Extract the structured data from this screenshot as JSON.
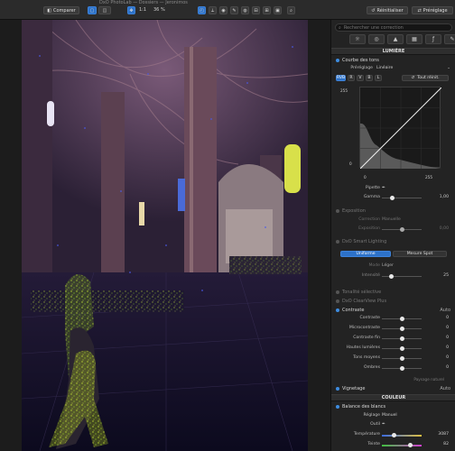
{
  "toolbar": {
    "window_title": "DxO PhotoLab — Dossiers — Jeronimos",
    "compare_label": "Comparer",
    "zoom_ratio": "1:1",
    "zoom_percent": "36 %",
    "reset_label": "Réinitialiser",
    "presets_label": "Préréglage"
  },
  "panel": {
    "search_placeholder": "Rechercher une correction",
    "luminance_header": "LUMIÈRE",
    "tone_curve": {
      "title": "Courbe des tons",
      "preset_label": "Préréglage",
      "preset_value": "Linéaire",
      "channels": [
        "RVB",
        "R",
        "V",
        "B",
        "L"
      ],
      "reset_all": "Tout réinit.",
      "top_value": "255",
      "bottom_left": "0",
      "input_low": "0",
      "input_high": "255",
      "pipette_label": "Pipette",
      "gamma_label": "Gamma",
      "gamma_value": "1,00",
      "gamma_level": 0.2
    },
    "exposure": {
      "title": "Exposition",
      "correction_label": "Correction",
      "correction_value": "Manuelle",
      "exposure_label": "Exposition",
      "exposure_value": "0,00",
      "exposure_level": 0.5
    },
    "smart_lighting": {
      "title": "DxO Smart Lighting",
      "mode_uniform": "Uniforme",
      "mode_spot": "Mesure Spot",
      "mode_label": "Mode",
      "mode_value": "Léger",
      "intensity_label": "Intensité",
      "intensity_value": "25",
      "intensity_level": 0.25
    },
    "selective_tone": {
      "title": "Tonalité sélective"
    },
    "clearview": {
      "title": "DxO ClearView Plus"
    },
    "contrast": {
      "title": "Contraste",
      "auto_label": "Auto",
      "rows": [
        {
          "label": "Contraste",
          "value": "0",
          "level": 0.5
        },
        {
          "label": "Microcontraste",
          "value": "0",
          "level": 0.5
        },
        {
          "label": "Contraste fin",
          "value": "0",
          "level": 0.5
        },
        {
          "label": "Hautes lumières",
          "value": "0",
          "level": 0.5
        },
        {
          "label": "Tons moyens",
          "value": "0",
          "level": 0.5
        },
        {
          "label": "Ombres",
          "value": "0",
          "level": 0.5
        }
      ],
      "note": "Paysage naturel"
    },
    "vignetting": {
      "title": "Vignetage",
      "auto_label": "Auto"
    },
    "color_header": "COULEUR",
    "white_balance": {
      "title": "Balance des blancs",
      "setting_label": "Réglage",
      "setting_value": "Manuel",
      "picker_label": "Outil",
      "temperature_label": "Température",
      "temperature_value": "3087",
      "temperature_level": 0.3,
      "tint_label": "Teinte",
      "tint_value": "82",
      "tint_level": 0.7
    }
  },
  "colors": {
    "accent": "#2d72c9",
    "panel_bg": "#232323",
    "toolbar_bg": "#2b2b2b"
  }
}
